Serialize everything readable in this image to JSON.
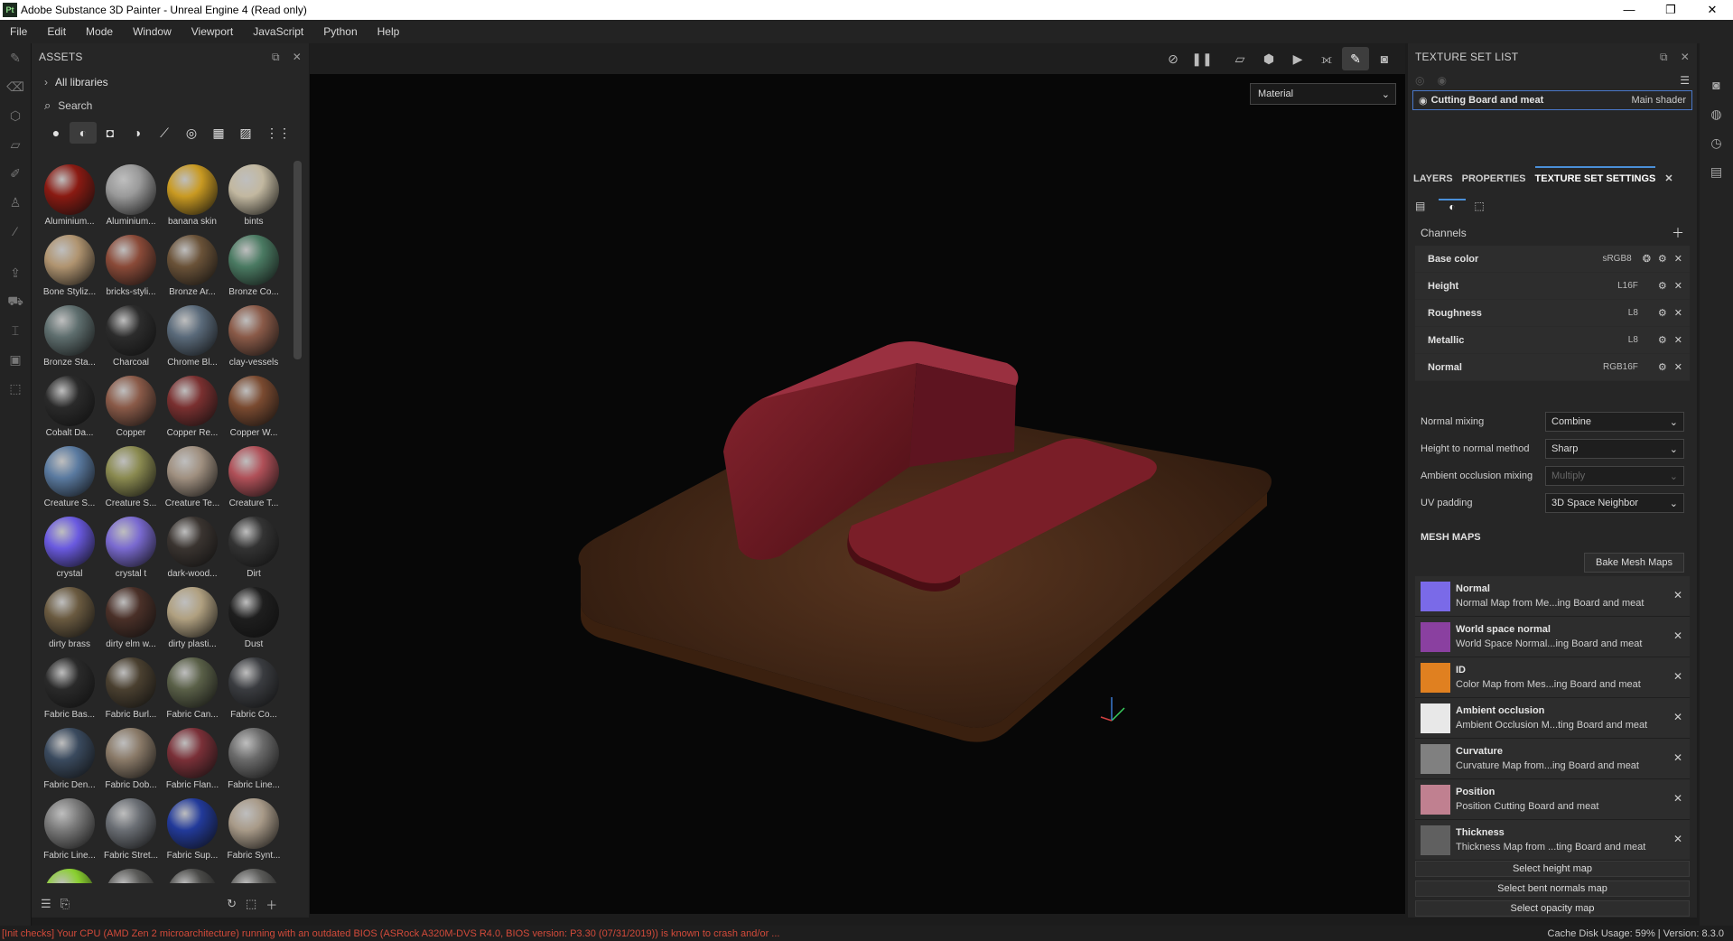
{
  "app": {
    "logo": "Pt",
    "title": "Adobe Substance 3D Painter - Unreal Engine 4 (Read only)",
    "window_buttons": [
      "—",
      "❐",
      "✕"
    ]
  },
  "menu": [
    "File",
    "Edit",
    "Mode",
    "Window",
    "Viewport",
    "JavaScript",
    "Python",
    "Help"
  ],
  "assets": {
    "title": "ASSETS",
    "libraries_label": "All libraries",
    "search_placeholder": "Search",
    "items": [
      {
        "label": "Aluminium...",
        "color": "#8a1a12"
      },
      {
        "label": "Aluminium...",
        "color": "#9a9a9a"
      },
      {
        "label": "banana skin",
        "color": "#c99a22"
      },
      {
        "label": "bints",
        "color": "#c2b8a0"
      },
      {
        "label": "Bone Styliz...",
        "color": "#b09470"
      },
      {
        "label": "bricks-styli...",
        "color": "#8a4a38"
      },
      {
        "label": "Bronze Ar...",
        "color": "#6a5238"
      },
      {
        "label": "Bronze Co...",
        "color": "#4a7a62"
      },
      {
        "label": "Bronze Sta...",
        "color": "#5e6e6e"
      },
      {
        "label": "Charcoal",
        "color": "#2c2c2c"
      },
      {
        "label": "Chrome Bl...",
        "color": "#5a6a7a"
      },
      {
        "label": "clay-vessels",
        "color": "#8a5a48"
      },
      {
        "label": "Cobalt Da...",
        "color": "#2a2a2a"
      },
      {
        "label": "Copper",
        "color": "#8a5a48"
      },
      {
        "label": "Copper Re...",
        "color": "#7a3030"
      },
      {
        "label": "Copper W...",
        "color": "#7a4a30"
      },
      {
        "label": "Creature S...",
        "color": "#5a7aa0"
      },
      {
        "label": "Creature S...",
        "color": "#8a8a50"
      },
      {
        "label": "Creature Te...",
        "color": "#a09080"
      },
      {
        "label": "Creature T...",
        "color": "#b05058"
      },
      {
        "label": "crystal",
        "color": "#6a5ae0"
      },
      {
        "label": "crystal t",
        "color": "#7a6ad0"
      },
      {
        "label": "dark-wood...",
        "color": "#3a3430"
      },
      {
        "label": "Dirt",
        "color": "#333333"
      },
      {
        "label": "dirty brass",
        "color": "#6a5a40"
      },
      {
        "label": "dirty elm w...",
        "color": "#4a3028"
      },
      {
        "label": "dirty plasti...",
        "color": "#b0a080"
      },
      {
        "label": "Dust",
        "color": "#1e1e1e"
      },
      {
        "label": "Fabric Bas...",
        "color": "#2a2a2a"
      },
      {
        "label": "Fabric Burl...",
        "color": "#4a4030"
      },
      {
        "label": "Fabric Can...",
        "color": "#5a6048"
      },
      {
        "label": "Fabric Co...",
        "color": "#3a3c40"
      },
      {
        "label": "Fabric Den...",
        "color": "#3a4a5e"
      },
      {
        "label": "Fabric Dob...",
        "color": "#8a7a68"
      },
      {
        "label": "Fabric Flan...",
        "color": "#7a3038"
      },
      {
        "label": "Fabric Line...",
        "color": "#6a6a6a"
      },
      {
        "label": "Fabric Line...",
        "color": "#7a7a7a"
      },
      {
        "label": "Fabric Stret...",
        "color": "#6a6e74"
      },
      {
        "label": "Fabric Sup...",
        "color": "#223a9a"
      },
      {
        "label": "Fabric Synt...",
        "color": "#a89a88"
      },
      {
        "label": "",
        "color": "#8ad030"
      },
      {
        "label": "",
        "color": "#5a5a58"
      },
      {
        "label": "",
        "color": "#4a4a48"
      },
      {
        "label": "",
        "color": "#5a5a58"
      }
    ]
  },
  "viewport": {
    "material_mode": "Material"
  },
  "texture_set_list": {
    "title": "TEXTURE SET LIST",
    "set_name": "Cutting Board and meat",
    "shader": "Main shader"
  },
  "tabs": [
    "LAYERS",
    "PROPERTIES",
    "TEXTURE SET SETTINGS"
  ],
  "channels_label": "Channels",
  "channels": [
    {
      "name": "Base color",
      "format": "sRGB8"
    },
    {
      "name": "Height",
      "format": "L16F"
    },
    {
      "name": "Roughness",
      "format": "L8"
    },
    {
      "name": "Metallic",
      "format": "L8"
    },
    {
      "name": "Normal",
      "format": "RGB16F"
    }
  ],
  "settings": [
    {
      "label": "Normal mixing",
      "value": "Combine",
      "enabled": true
    },
    {
      "label": "Height to normal method",
      "value": "Sharp",
      "enabled": true
    },
    {
      "label": "Ambient occlusion mixing",
      "value": "Multiply",
      "enabled": false
    },
    {
      "label": "UV padding",
      "value": "3D Space Neighbor",
      "enabled": true
    }
  ],
  "mesh_maps_title": "MESH MAPS",
  "bake_button": "Bake Mesh Maps",
  "mesh_maps": [
    {
      "name": "Normal",
      "desc": "Normal Map from Me...ing Board and meat",
      "color": "#7a6ae8"
    },
    {
      "name": "World space normal",
      "desc": "World Space Normal...ing Board and meat",
      "color": "#8a40a0"
    },
    {
      "name": "ID",
      "desc": "Color Map from Mes...ing Board and meat",
      "color": "#e08020"
    },
    {
      "name": "Ambient occlusion",
      "desc": "Ambient Occlusion M...ting Board and meat",
      "color": "#e8e8e8"
    },
    {
      "name": "Curvature",
      "desc": "Curvature Map from...ing Board and meat",
      "color": "#808080"
    },
    {
      "name": "Position",
      "desc": "Position Cutting Board and meat",
      "color": "#c08090"
    },
    {
      "name": "Thickness",
      "desc": "Thickness Map from ...ting Board and meat",
      "color": "#606060"
    }
  ],
  "select_buttons": [
    "Select height map",
    "Select bent normals map",
    "Select opacity map"
  ],
  "status": {
    "error": "[Init checks] Your CPU (AMD Zen 2 microarchitecture) running with an outdated BIOS (ASRock A320M-DVS R4.0, BIOS version: P3.30 (07/31/2019)) is known to crash and/or ...",
    "cache": "Cache Disk Usage:   59% | Version: 8.3.0"
  }
}
